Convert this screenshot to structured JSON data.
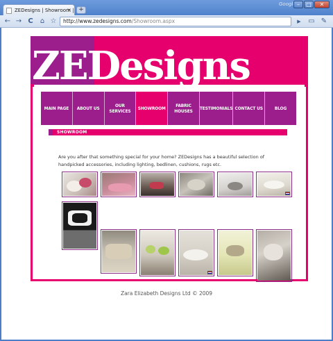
{
  "browser": {
    "tab_title": "ZEDesigns | Showroom | A ...",
    "tab_close": "×",
    "new_tab": "+",
    "google_label": "Google",
    "window_controls": {
      "minimize": "–",
      "maximize": "□",
      "close": "✕"
    },
    "url_host": "http://www.zedesigns.com",
    "url_path": "/Showroom.aspx",
    "back_icon": "←",
    "forward_icon": "→",
    "reload_icon": "C",
    "home_icon": "⌂",
    "star_icon": "☆",
    "go_icon": "▶",
    "page_icon": "▭",
    "tools_icon": "✎"
  },
  "site": {
    "logo_text": "ZEDesigns",
    "nav": [
      {
        "label": "MAIN PAGE"
      },
      {
        "label": "ABOUT US"
      },
      {
        "label": "OUR SERVICES"
      },
      {
        "label": "SHOWROOM",
        "active": true
      },
      {
        "label": "FABRIC HOUSES"
      },
      {
        "label": "TESTIMONIALS"
      },
      {
        "label": "CONTACT US"
      },
      {
        "label": "BLOG"
      }
    ],
    "section_title": "SHOWROOM",
    "intro": "Are you after that something special for your home? ZEDesigns has a beautiful selection of handpicked accessories, including lighting, bedlinen, cushions, rugs etc.",
    "footer": "Zara Elizabeth Designs Ltd © 2009",
    "colors": {
      "magenta": "#e5006d",
      "purple": "#9b1e8c"
    }
  }
}
